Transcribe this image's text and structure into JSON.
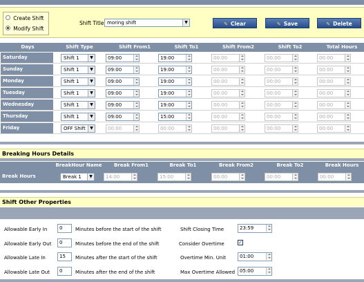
{
  "toolbar": {
    "mode_options": [
      "Create Shift",
      "Modify Shift"
    ],
    "selected_mode": "Modify Shift",
    "shift_title_label": "Shift Title",
    "shift_title_value": "moring shift",
    "clear_label": "Clear",
    "save_label": "Save",
    "delete_label": "Delete"
  },
  "schedule": {
    "headers": [
      "Days",
      "Shift Type",
      "Shift From1",
      "Shift To1",
      "Shift From2",
      "Shift To2",
      "Total Hours"
    ],
    "rows": [
      {
        "day": "Saturday",
        "type": "Shift 1",
        "from1": "09:00",
        "to1": "19:00",
        "from2": "00:00",
        "to2": "00:00",
        "total": "00:00"
      },
      {
        "day": "Sunday",
        "type": "Shift 1",
        "from1": "09:00",
        "to1": "19:00",
        "from2": "00:00",
        "to2": "00:00",
        "total": "00:00"
      },
      {
        "day": "Monday",
        "type": "Shift 1",
        "from1": "09:00",
        "to1": "19:00",
        "from2": "00:00",
        "to2": "00:00",
        "total": "00:00"
      },
      {
        "day": "Tuesday",
        "type": "Shift 1",
        "from1": "09:00",
        "to1": "19:00",
        "from2": "00:00",
        "to2": "00:00",
        "total": "00:00"
      },
      {
        "day": "Wednesday",
        "type": "Shift 1",
        "from1": "09:00",
        "to1": "19:00",
        "from2": "00:00",
        "to2": "00:00",
        "total": "00:00"
      },
      {
        "day": "Thursday",
        "type": "Shift 1",
        "from1": "09:00",
        "to1": "15:00",
        "from2": "00:00",
        "to2": "00:00",
        "total": "00:00"
      },
      {
        "day": "Friday",
        "type": "OFF Shift",
        "from1": "00:00",
        "to1": "00:00",
        "from2": "00:00",
        "to2": "00:00",
        "total": "00:00"
      }
    ]
  },
  "breaking": {
    "section_title": "Breaking Hours Details",
    "headers": [
      "BreakHour Name",
      "Break From1",
      "Break To1",
      "Break From2",
      "Break To2",
      "Break Hours"
    ],
    "row_label": "Break Hours",
    "name": "Break 1",
    "from1": "14:00",
    "to1": "15:00",
    "from2": "00:00",
    "to2": "00:00",
    "total": "00:00"
  },
  "other": {
    "section_title": "Shift Other Properties",
    "early_in_label": "Allowable Early In",
    "early_in_value": "0",
    "early_in_desc": "Minutes before the start of the shift",
    "early_out_label": "Allowable Early Out",
    "early_out_value": "0",
    "early_out_desc": "Minutes before the end of the shift",
    "late_in_label": "Allowable Late In",
    "late_in_value": "15",
    "late_in_desc": "Minutes after the start of the shift",
    "late_out_label": "Allowable Late Out",
    "late_out_value": "0",
    "late_out_desc": "Minutes after the end of the shift",
    "closing_time_label": "Shift Closing Time",
    "closing_time_value": "23:59",
    "consider_overtime_label": "Consider Overtime",
    "consider_overtime_checked": true,
    "overtime_unit_label": "Overtime Min. Unit",
    "overtime_unit_value": "01:00",
    "max_overtime_label": "Max Overtime Allowed",
    "max_overtime_value": "05:00"
  },
  "colors": {
    "header_bg": "#7f8fa6",
    "toolbar_bg": "#ffffc4",
    "button_bg": "#284e8a"
  }
}
